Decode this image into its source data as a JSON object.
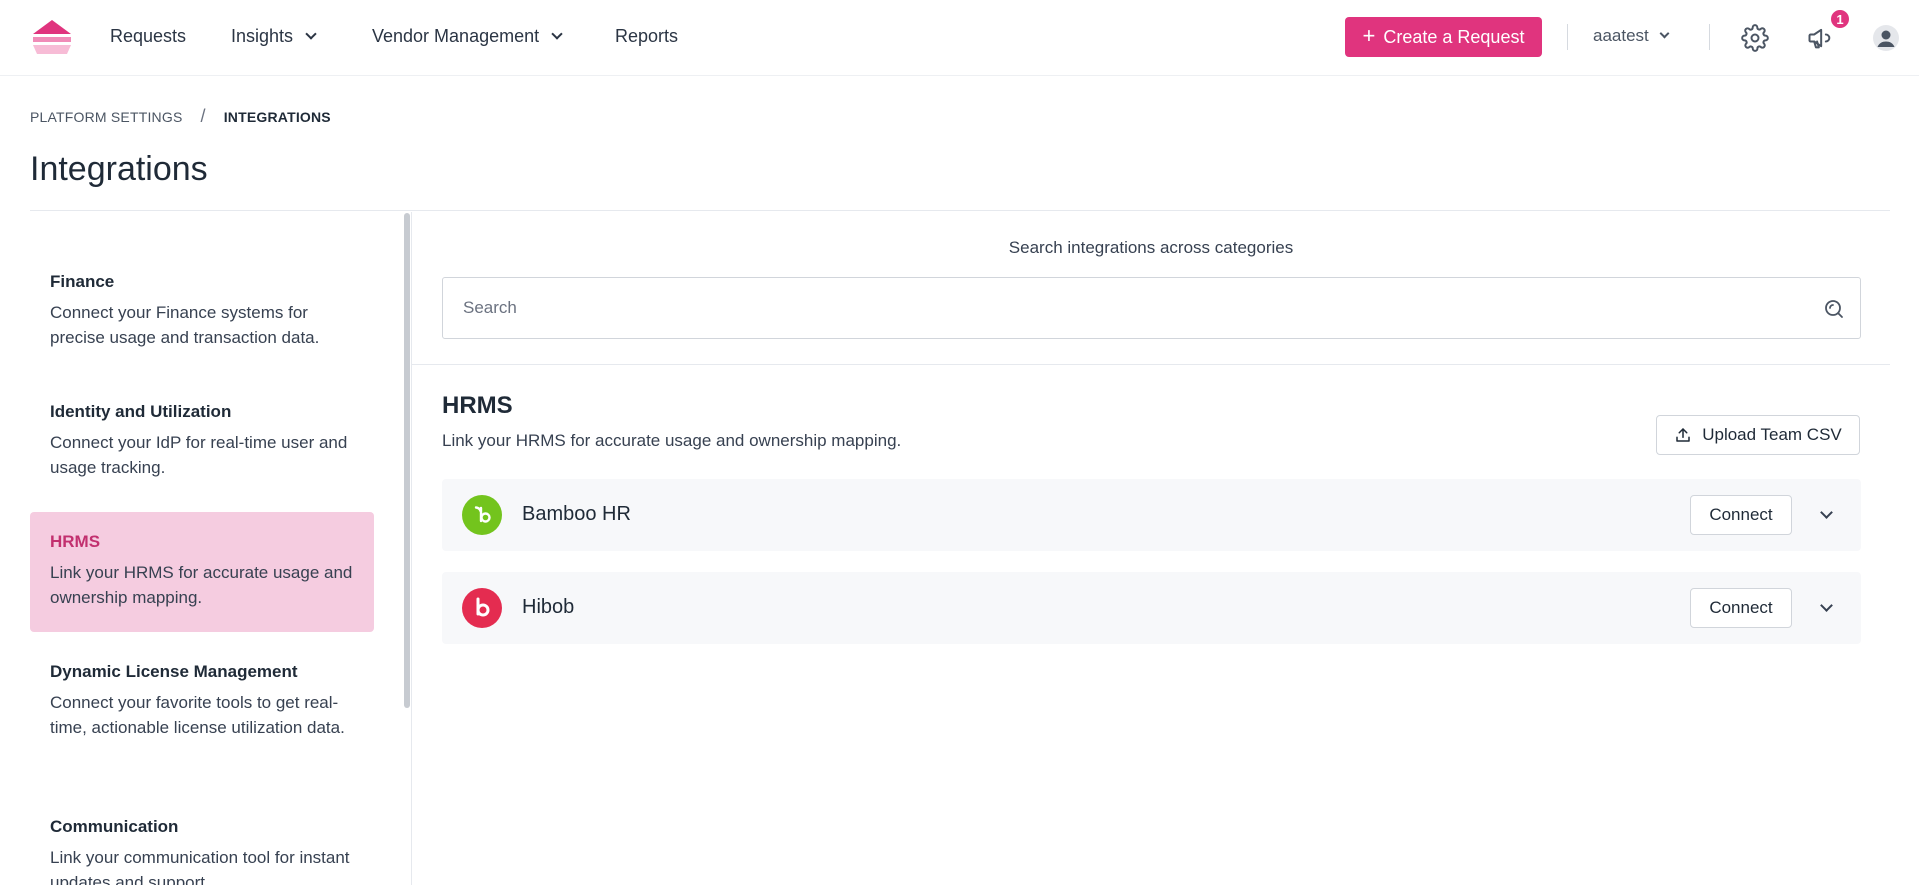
{
  "nav": {
    "logo_icon": "brand-logo",
    "items": [
      {
        "label": "Requests",
        "dropdown": false
      },
      {
        "label": "Insights",
        "dropdown": true
      },
      {
        "label": "Vendor Management",
        "dropdown": true
      },
      {
        "label": "Reports",
        "dropdown": false
      }
    ],
    "create_button": "Create a Request",
    "user": "aaatest",
    "notification_count": "1",
    "accent": "#e0347e"
  },
  "breadcrumb": {
    "parent": "PLATFORM SETTINGS",
    "separator": "/",
    "current": "INTEGRATIONS"
  },
  "page_title": "Integrations",
  "sidebar": {
    "categories": [
      {
        "title": "Finance",
        "desc": "Connect your Finance systems for precise usage and transaction data.",
        "active": false
      },
      {
        "title": "Identity and Utilization",
        "desc": "Connect your IdP for real-time user and usage tracking.",
        "active": false
      },
      {
        "title": "HRMS",
        "desc": "Link your HRMS for accurate usage and ownership mapping.",
        "active": true
      },
      {
        "title": "Dynamic License Management",
        "desc": "Connect your favorite tools to get real-time, actionable license utilization data.",
        "active": false
      },
      {
        "title": "Communication",
        "desc": "Link your communication tool for instant updates and support.",
        "active": false
      }
    ]
  },
  "search": {
    "label": "Search integrations across categories",
    "placeholder": "Search",
    "value": ""
  },
  "section": {
    "title": "HRMS",
    "desc": "Link your HRMS for accurate usage and ownership mapping.",
    "upload_button": "Upload Team CSV"
  },
  "integrations": [
    {
      "name": "Bamboo HR",
      "logo_icon": "bamboohr-logo",
      "logo_color": "#73c41d",
      "button": "Connect"
    },
    {
      "name": "Hibob",
      "logo_icon": "hibob-logo",
      "logo_color": "#e42c50",
      "button": "Connect"
    }
  ]
}
